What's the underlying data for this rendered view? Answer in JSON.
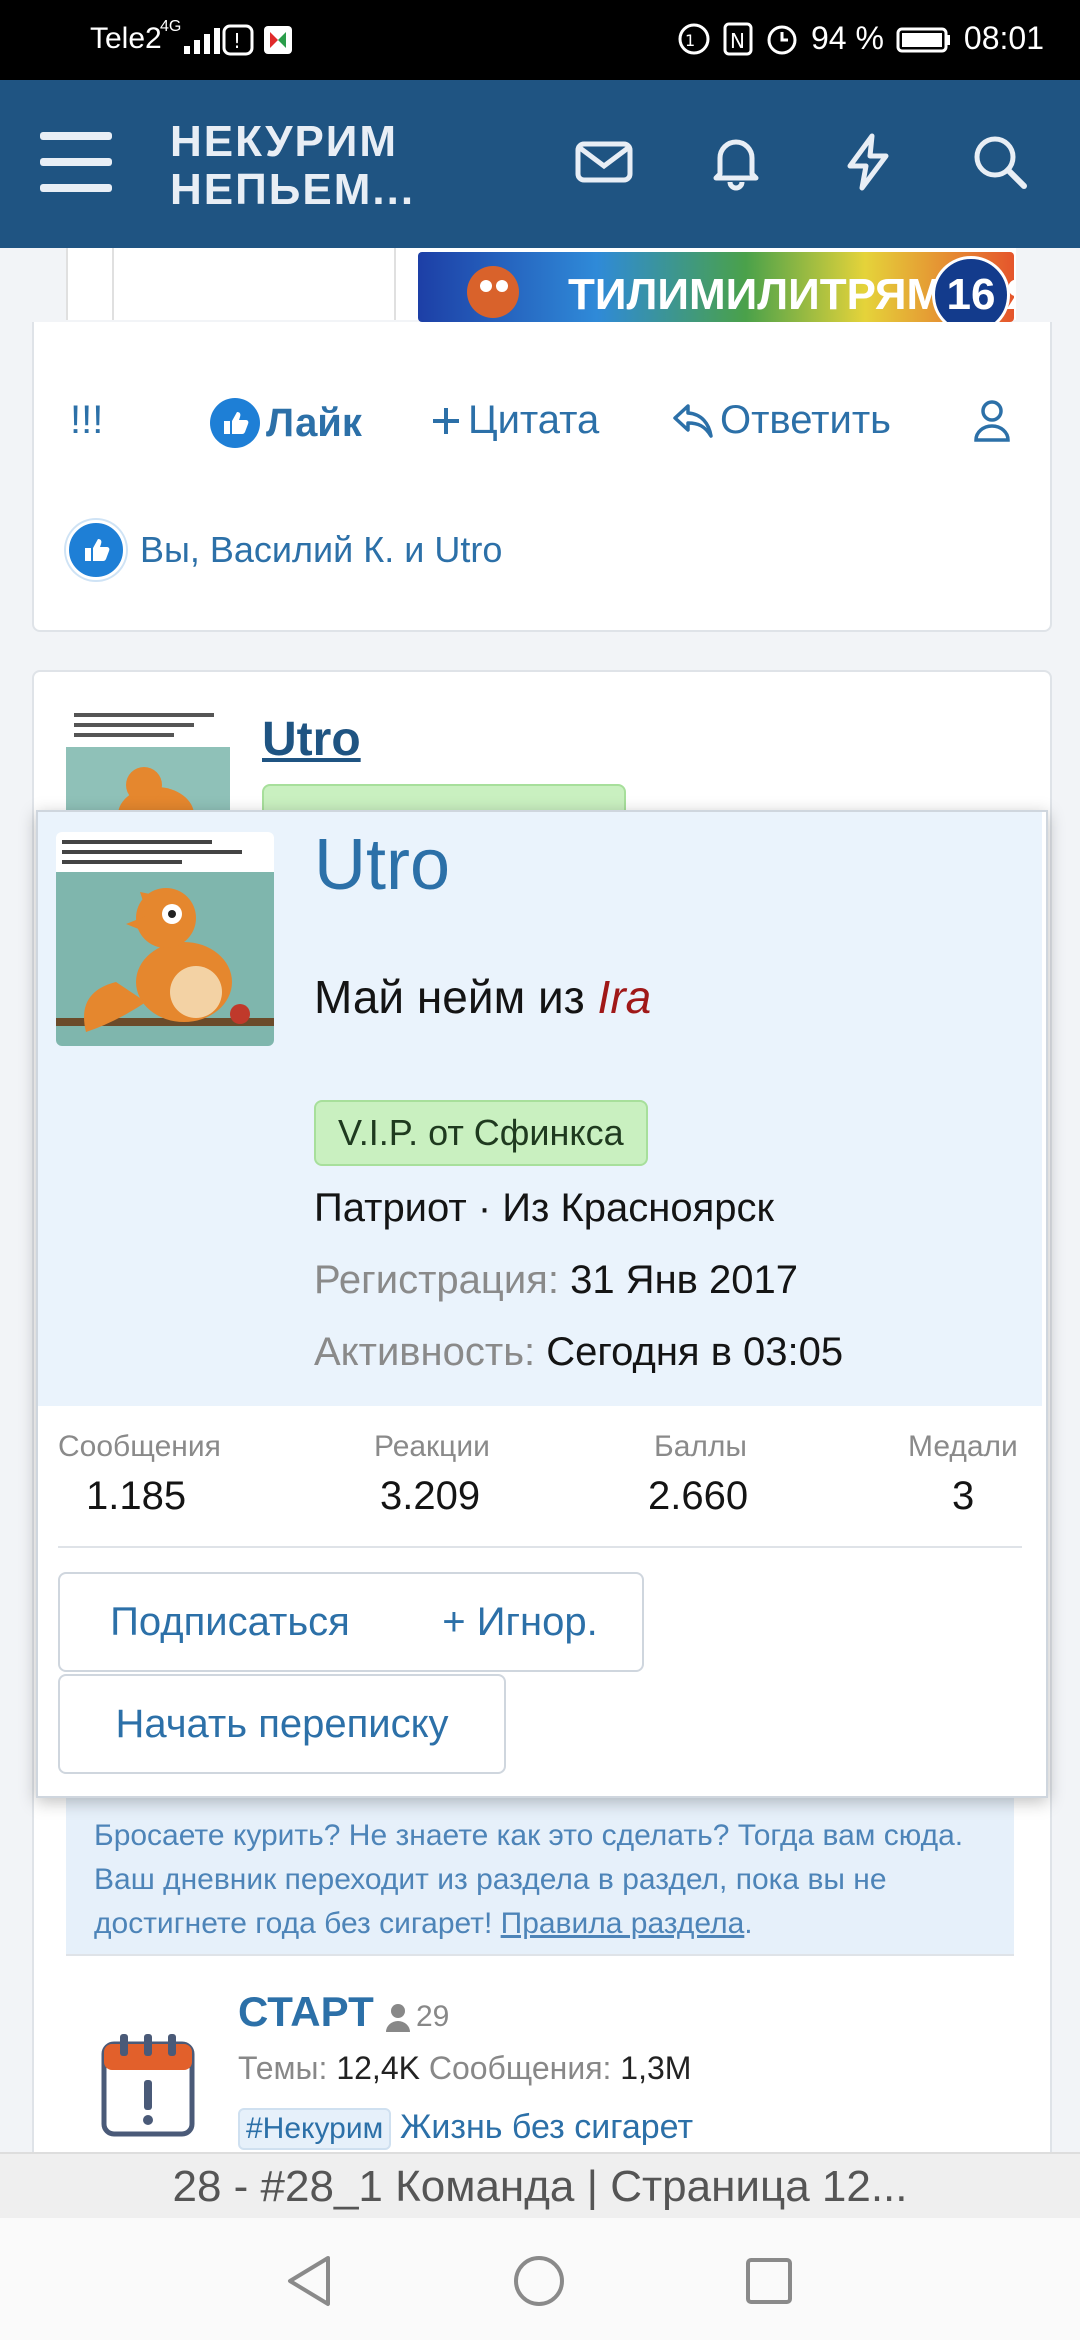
{
  "status_bar": {
    "carrier": "Tele2",
    "network": "4G",
    "battery": "94 %",
    "time": "08:01"
  },
  "header": {
    "logo_line1": "НЕКУРИМ",
    "logo_line2": "НЕПЬЕМ..."
  },
  "banner": {
    "text": "ТИЛИМИЛИТРЯМДИЯ",
    "number": "16"
  },
  "post_actions": {
    "report": "!!!",
    "like": "Лайк",
    "quote": "Цитата",
    "reply": "Ответить"
  },
  "likes_summary": "Вы, Василий К. и Utro",
  "card2": {
    "username": "Utro"
  },
  "popup": {
    "username": "Utro",
    "title_prefix": "Май нейм из ",
    "title_em": "Ira",
    "banner": "V.I.P. от Сфинкса",
    "location": "Патриот · Из Красноярск",
    "registration_label": "Регистрация:",
    "registration_value": "31 Янв 2017",
    "activity_label": "Активность:",
    "activity_value": "Сегодня в 03:05",
    "stats": [
      {
        "label": "Сообщения",
        "value": "1.185"
      },
      {
        "label": "Реакции",
        "value": "3.209"
      },
      {
        "label": "Баллы",
        "value": "2.660"
      },
      {
        "label": "Медали",
        "value": "3"
      }
    ],
    "buttons": {
      "follow": "Подписаться",
      "ignore": "+ Игнор.",
      "message": "Начать переписку"
    }
  },
  "forum": {
    "description": "Бросаете курить? Не знаете как это сделать? Тогда вам сюда. Ваш дневник переходит из раздела в раздел, пока вы не достигнете года без сигарет!",
    "rules_link": "Правила раздела",
    "node_title": "СТАРТ",
    "node_count": "29",
    "threads_label": "Темы:",
    "threads_value": "12,4K",
    "messages_label": "Сообщения:",
    "messages_value": "1,3M",
    "tag": "#Некурим",
    "last_thread": "Жизнь без сигарет"
  },
  "page_title": "28 - #28_1 Команда | Страница 12..."
}
